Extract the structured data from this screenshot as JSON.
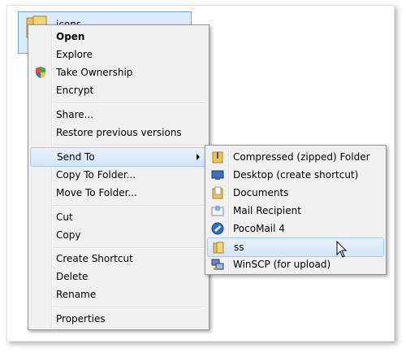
{
  "desktop": {
    "folder_label": "icons"
  },
  "context_menu": {
    "items": [
      {
        "label": "Open"
      },
      {
        "label": "Explore"
      },
      {
        "label": "Take Ownership"
      },
      {
        "label": "Encrypt"
      },
      {
        "label": "Share..."
      },
      {
        "label": "Restore previous versions"
      },
      {
        "label": "Send To"
      },
      {
        "label": "Copy To Folder..."
      },
      {
        "label": "Move To Folder..."
      },
      {
        "label": "Cut"
      },
      {
        "label": "Copy"
      },
      {
        "label": "Create Shortcut"
      },
      {
        "label": "Delete"
      },
      {
        "label": "Rename"
      },
      {
        "label": "Properties"
      }
    ]
  },
  "send_to_menu": {
    "items": [
      {
        "label": "Compressed (zipped) Folder",
        "icon": "zip-folder-icon"
      },
      {
        "label": "Desktop (create shortcut)",
        "icon": "desktop-icon"
      },
      {
        "label": "Documents",
        "icon": "documents-folder-icon"
      },
      {
        "label": "Mail Recipient",
        "icon": "mail-icon"
      },
      {
        "label": "PocoMail 4",
        "icon": "pocomail-icon"
      },
      {
        "label": "ss",
        "icon": "folder-icon"
      },
      {
        "label": "WinSCP (for upload)",
        "icon": "winscp-icon"
      }
    ]
  },
  "colors": {
    "highlight_border": "#a8cbf0",
    "menu_bg": "#f0f0f0",
    "selection_bg": "#dcebfc"
  }
}
